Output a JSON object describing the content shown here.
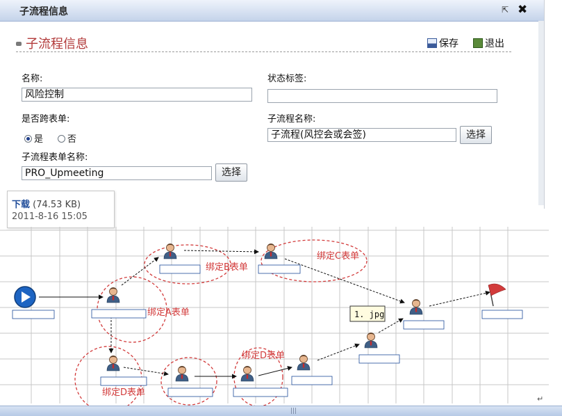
{
  "dialog": {
    "title": "子流程信息",
    "heading": "子流程信息",
    "save_label": "保存",
    "exit_label": "退出",
    "name_label": "名称:",
    "name_value": "风险控制",
    "status_label": "状态标签:",
    "status_value": "",
    "cross_form_label": "是否跨表单:",
    "radio_yes": "是",
    "radio_no": "否",
    "subflow_name_label": "子流程名称:",
    "subflow_name_value": "子流程(风控会或会签)",
    "subform_name_label": "子流程表单名称:",
    "subform_name_value": "PRO_Upmeeting",
    "choose_label": "选择"
  },
  "tooltip": {
    "download_label": "下载",
    "size": "(74.53 KB)",
    "date": "2011-8-16 15:05"
  },
  "diagram": {
    "annotations": {
      "bind_a_top": "绑定B表单",
      "bind_c_top": "绑定C表单",
      "bind_a": "绑定A表单",
      "bind_d_left": "绑定D表单",
      "bind_d_mid": "绑定D表单"
    },
    "callout": "1. jpg"
  },
  "colors": {
    "accent_red": "#d23b3b",
    "title_blue": "#c4d3ea",
    "link_blue": "#1f4c9a"
  },
  "misc": {
    "pilcrow": "↵",
    "grip": "|||"
  }
}
